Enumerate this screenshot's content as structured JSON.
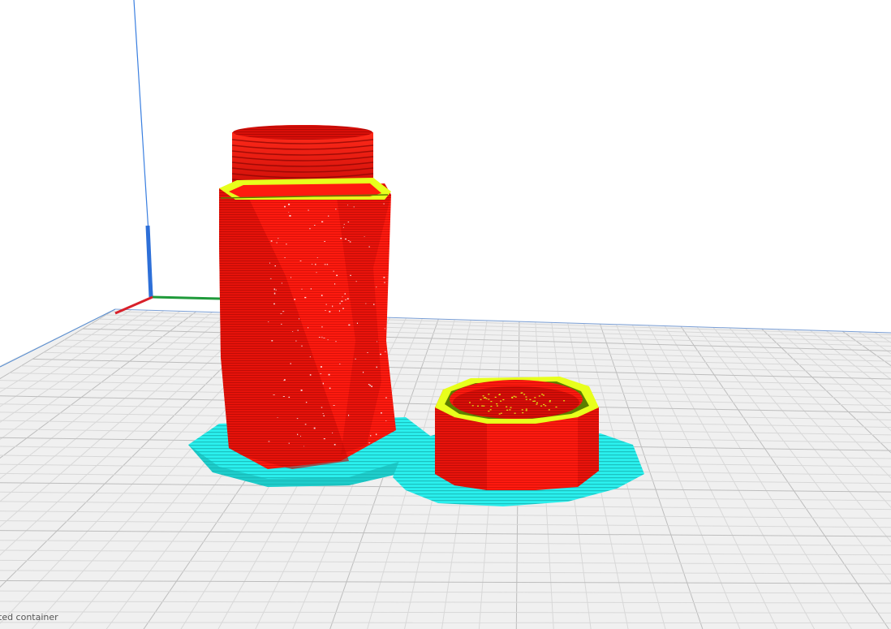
{
  "colors": {
    "background": "#ffffff",
    "bed": "#f0f0f0",
    "grid_minor": "#d6d6d6",
    "grid_major": "#bcbcbc",
    "bed_edge": "#5b8fd0",
    "axis_x": "#d8202a",
    "axis_y": "#1f9a3a",
    "axis_z": "#2d6fd8",
    "wall_outer": "#ff1a0f",
    "wall_shade": "#d80e08",
    "top_skin": "#e8ff1c",
    "infill": "#5c7d00",
    "support": "#2af0ee",
    "support_shade": "#17b6b4"
  },
  "viewport": {
    "mode": "layer-view",
    "objects": [
      "tall-twisted-container",
      "container-lid"
    ]
  },
  "status": {
    "text": "ted container"
  }
}
